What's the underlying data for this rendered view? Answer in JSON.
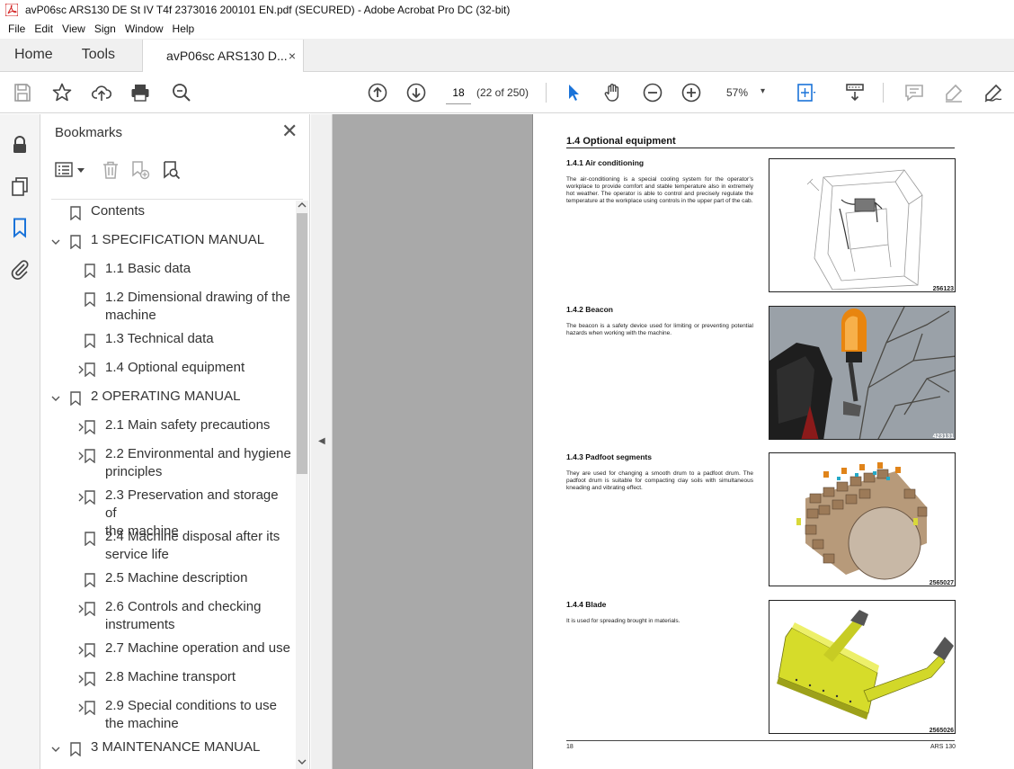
{
  "window": {
    "title": "avP06sc ARS130 DE St IV T4f 2373016 200101 EN.pdf (SECURED) - Adobe Acrobat Pro DC (32-bit)"
  },
  "menu": [
    "File",
    "Edit",
    "View",
    "Sign",
    "Window",
    "Help"
  ],
  "tabs": {
    "home": "Home",
    "tools": "Tools",
    "document": "avP06sc ARS130 D...",
    "close": "×"
  },
  "toolbar": {
    "page_current": "18",
    "page_of": "(22 of 250)",
    "zoom": "57%",
    "zoom_caret": "▾"
  },
  "bookmarks": {
    "title": "Bookmarks",
    "close": "✕",
    "items": [
      {
        "label": "Contents",
        "level": 0,
        "arrow": "none"
      },
      {
        "label": "1 SPECIFICATION MANUAL",
        "level": 0,
        "arrow": "down"
      },
      {
        "label": "1.1 Basic data",
        "level": 1,
        "arrow": "none"
      },
      {
        "label": "1.2 Dimensional drawing of the",
        "label2": "machine",
        "level": 1,
        "arrow": "none"
      },
      {
        "label": "1.3 Technical data",
        "level": 1,
        "arrow": "none"
      },
      {
        "label": "1.4 Optional equipment",
        "level": 1,
        "arrow": "right"
      },
      {
        "label": "2 OPERATING MANUAL",
        "level": 0,
        "arrow": "down"
      },
      {
        "label": "2.1 Main safety precautions",
        "level": 1,
        "arrow": "right"
      },
      {
        "label": "2.2 Environmental and hygiene",
        "label2": "principles",
        "level": 1,
        "arrow": "right"
      },
      {
        "label": "2.3 Preservation and storage of",
        "label2": "the machine",
        "level": 1,
        "arrow": "right"
      },
      {
        "label": "2.4 Machine disposal after its",
        "label2": "service life",
        "level": 1,
        "arrow": "none"
      },
      {
        "label": "2.5 Machine description",
        "level": 1,
        "arrow": "none"
      },
      {
        "label": "2.6 Controls and checking",
        "label2": "instruments",
        "level": 1,
        "arrow": "right"
      },
      {
        "label": "2.7 Machine operation and use",
        "level": 1,
        "arrow": "right"
      },
      {
        "label": "2.8 Machine transport",
        "level": 1,
        "arrow": "right"
      },
      {
        "label": "2.9 Special conditions to use",
        "label2": "the machine",
        "level": 1,
        "arrow": "right"
      },
      {
        "label": "3 MAINTENANCE MANUAL",
        "level": 0,
        "arrow": "down"
      }
    ]
  },
  "pdf_page": {
    "section": "1.4      Optional equipment",
    "subsections": [
      {
        "heading": "1.4.1      Air conditioning",
        "text": "The air-conditioning is a special cooling system for the operator’s workplace to provide comfort and stable temperature also in extremely hot weather. The operator is able to control and precisely regulate the temperature at the workplace using controls in the upper part of the cab.",
        "figure": "256123"
      },
      {
        "heading": "1.4.2      Beacon",
        "text": "The beacon is a safety device used for limiting or preventing potential hazards when working with the machine.",
        "figure": "423131"
      },
      {
        "heading": "1.4.3      Padfoot segments",
        "text": "They are used for changing a smooth drum to a padfoot drum. The padfoot drum is suitable for compacting clay soils with simultaneous kneading and vibrating effect.",
        "figure": "2565027"
      },
      {
        "heading": "1.4.4      Blade",
        "text": "It is used for spreading brought in materials.",
        "figure": "2565026"
      }
    ],
    "footer_left": "18",
    "footer_right": "ARS 130"
  }
}
